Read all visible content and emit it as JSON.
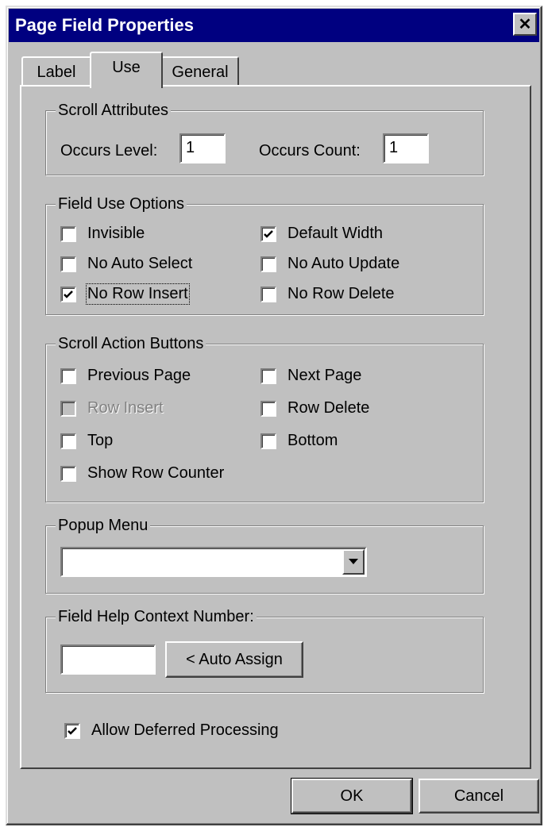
{
  "window": {
    "title": "Page Field Properties",
    "close_glyph": "✕"
  },
  "tabs": [
    {
      "label": "Label",
      "selected": false
    },
    {
      "label": "Use",
      "selected": true
    },
    {
      "label": "General",
      "selected": false
    }
  ],
  "scroll_attributes": {
    "legend": "Scroll Attributes",
    "occurs_level_label": "Occurs Level:",
    "occurs_level_value": "1",
    "occurs_count_label": "Occurs Count:",
    "occurs_count_value": "1"
  },
  "field_use_options": {
    "legend": "Field Use Options",
    "items": [
      {
        "label": "Invisible",
        "checked": false
      },
      {
        "label": "Default Width",
        "checked": true
      },
      {
        "label": "No Auto Select",
        "checked": false
      },
      {
        "label": "No Auto Update",
        "checked": false
      },
      {
        "label": "No Row Insert",
        "checked": true,
        "focused": true
      },
      {
        "label": "No Row Delete",
        "checked": false
      }
    ]
  },
  "scroll_action_buttons": {
    "legend": "Scroll Action Buttons",
    "items": [
      {
        "label": "Previous Page",
        "checked": false
      },
      {
        "label": "Next Page",
        "checked": false
      },
      {
        "label": "Row Insert",
        "checked": false,
        "disabled": true
      },
      {
        "label": "Row Delete",
        "checked": false
      },
      {
        "label": "Top",
        "checked": false
      },
      {
        "label": "Bottom",
        "checked": false
      },
      {
        "label": "Show Row Counter",
        "checked": false
      }
    ]
  },
  "popup_menu": {
    "legend": "Popup Menu",
    "selected_value": ""
  },
  "field_help": {
    "legend": "Field Help Context Number:",
    "value": "",
    "auto_assign_label": "< Auto Assign"
  },
  "allow_deferred": {
    "label": "Allow Deferred Processing",
    "checked": true
  },
  "buttons": {
    "ok_label": "OK",
    "cancel_label": "Cancel"
  },
  "icons": {
    "close": "close-icon",
    "dropdown": "chevron-down-icon",
    "check": "checkmark-icon"
  }
}
